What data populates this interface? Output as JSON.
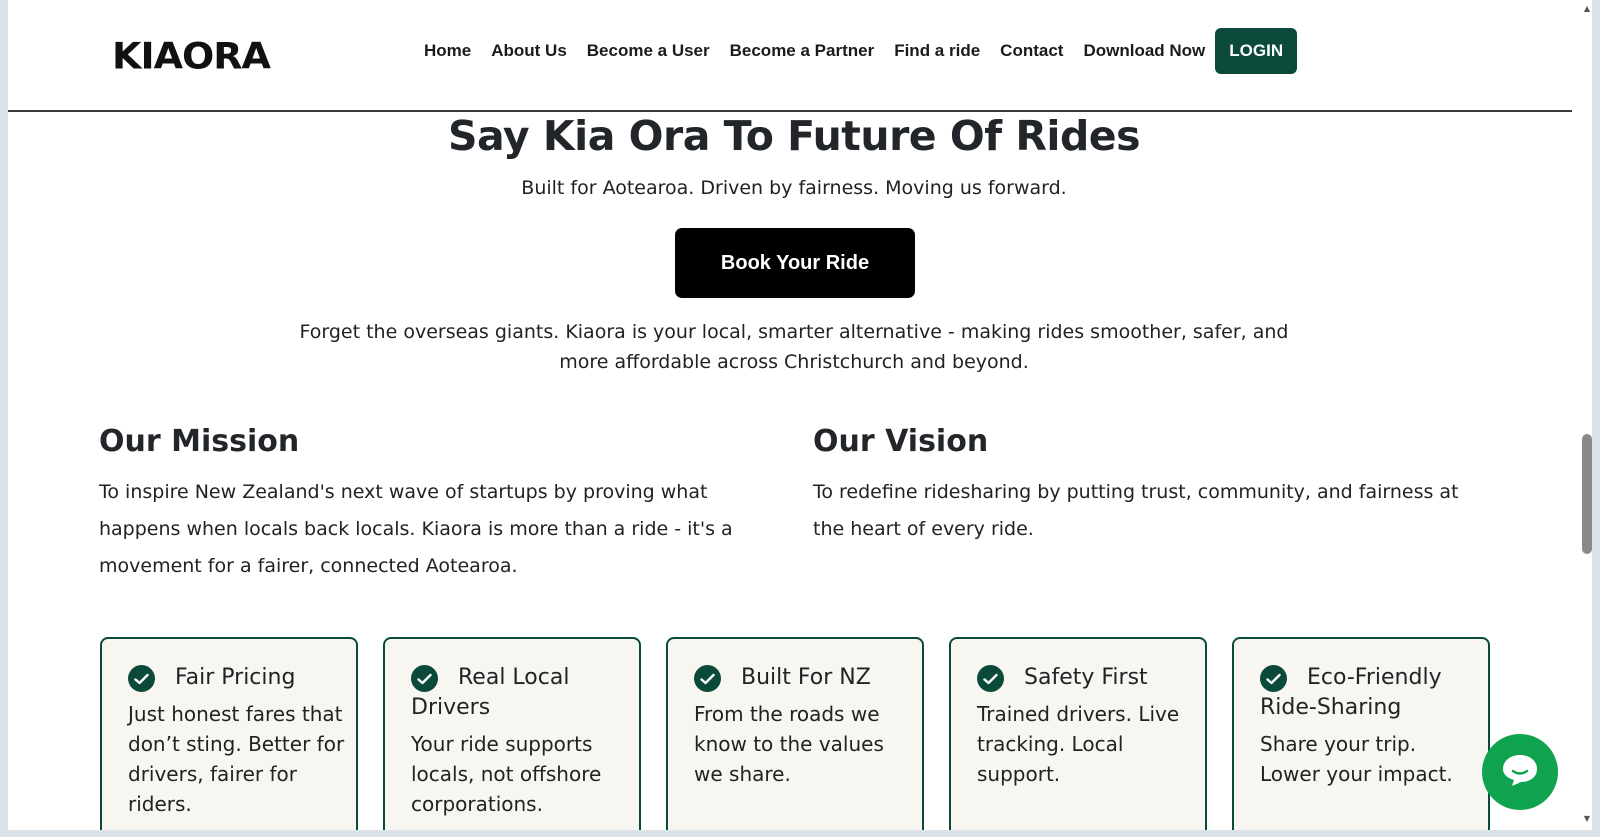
{
  "header": {
    "logo": "KIAORA",
    "nav": [
      "Home",
      "About Us",
      "Become a User",
      "Become a Partner",
      "Find a ride",
      "Contact",
      "Download Now"
    ],
    "login_label": "LOGIN"
  },
  "hero": {
    "title": "Say Kia Ora To Future Of Rides",
    "subtitle": "Built for Aotearoa. Driven by fairness. Moving us forward.",
    "cta_label": "Book Your Ride",
    "description": "Forget the overseas giants. Kiaora is your local, smarter alternative - making rides smoother, safer, and more affordable across Christchurch and beyond."
  },
  "mission": {
    "title": "Our Mission",
    "text": "To inspire New Zealand's next wave of startups by proving what happens when locals back locals. Kiaora is more than a ride - it's a movement for a fairer, connected Aotearoa."
  },
  "vision": {
    "title": "Our Vision",
    "text": "To redefine ridesharing by putting trust, community, and fairness at the heart of every ride."
  },
  "features": [
    {
      "title": "Fair Pricing",
      "text": "Just honest fares that don’t sting. Better for drivers, fairer for riders."
    },
    {
      "title": "Real Local Drivers",
      "text": "Your ride supports locals, not offshore corporations."
    },
    {
      "title": "Built For NZ",
      "text": "From the roads we know to the values we share."
    },
    {
      "title": "Safety First",
      "text": "Trained drivers. Live tracking. Local support."
    },
    {
      "title": "Eco-Friendly Ride-Sharing",
      "text": "Share your trip. Lower your impact."
    }
  ],
  "colors": {
    "brand_green": "#0b4a3a",
    "chat_green": "#0fa34f"
  },
  "icons": {
    "check": "check-icon",
    "chat": "chat-bubble-icon"
  }
}
